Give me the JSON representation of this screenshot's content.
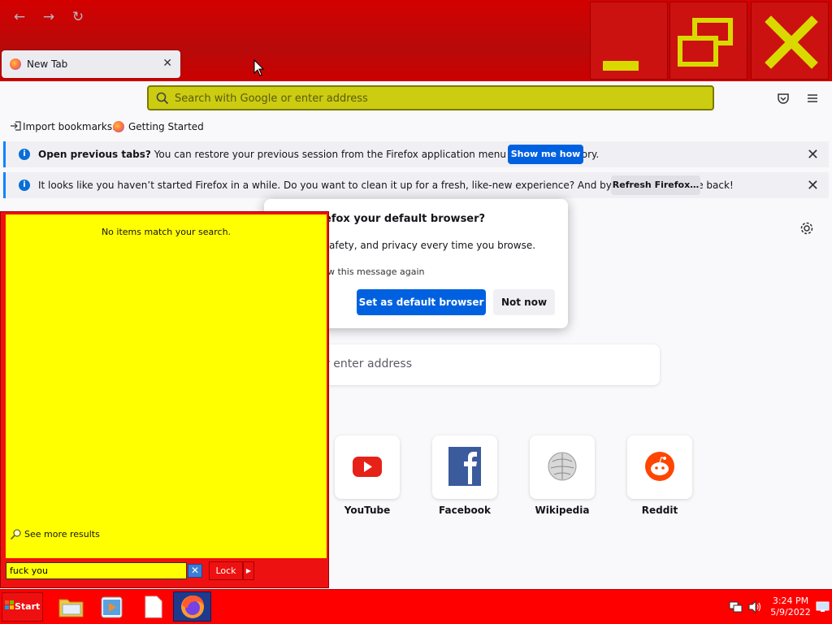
{
  "window": {
    "tab_title": "New Tab",
    "controls": [
      "minimize",
      "restore",
      "close"
    ]
  },
  "navbar": {
    "url_placeholder": "Search with Google or enter address"
  },
  "bookmarks": {
    "items": [
      {
        "label": "Import bookmarks…",
        "icon": "import-icon"
      },
      {
        "label": "Getting Started",
        "icon": "firefox-icon"
      }
    ]
  },
  "notifications": [
    {
      "bold": "Open previous tabs?",
      "text": " You can restore your previous session from the Firefox application menu",
      "text_after": ", under History.",
      "button": "Show me how"
    },
    {
      "text": "It looks like you haven’t started Firefox in a while. Do you want to clean it up for a fresh, like-new experience? And by the way, welcome back!",
      "button": "Refresh Firefox…"
    }
  ],
  "dialog": {
    "title": "efox your default browser?",
    "body": "afety, and privacy every time you browse.",
    "checkbox": "w this message again",
    "primary": "Set as default browser",
    "secondary": "Not now"
  },
  "newtab": {
    "search_placeholder": "r enter address",
    "top_sites": [
      {
        "label": "YouTube",
        "icon": "youtube-icon"
      },
      {
        "label": "Facebook",
        "icon": "facebook-icon"
      },
      {
        "label": "Wikipedia",
        "icon": "wikipedia-icon"
      },
      {
        "label": "Reddit",
        "icon": "reddit-icon"
      }
    ]
  },
  "start_search": {
    "no_items": "No items match your search.",
    "see_more": "See more results",
    "query": "fuck you",
    "lock_label": "Lock"
  },
  "taskbar": {
    "start_label": "Start",
    "time": "3:24 PM",
    "date": "5/9/2022"
  },
  "colors": {
    "titlebar": "#cc0000",
    "urlbar": "#cccc11",
    "search_results_bg": "#ffff00",
    "taskbar": "#ff0000",
    "accent_blue": "#0061e0"
  }
}
